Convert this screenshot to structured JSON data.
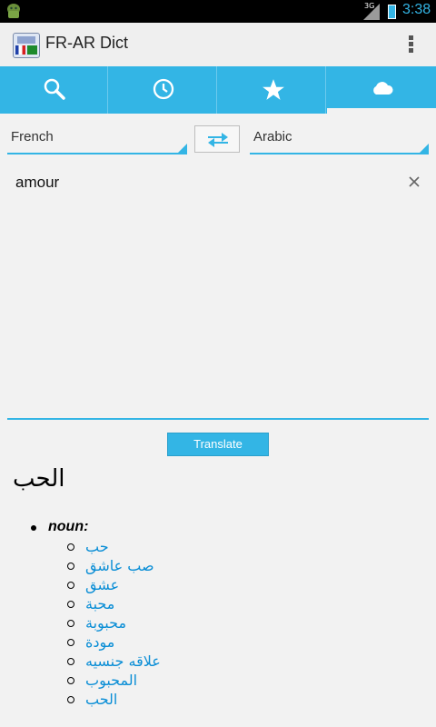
{
  "status_bar": {
    "network": "3G",
    "time": "3:38"
  },
  "action_bar": {
    "title": "FR-AR Dict",
    "icon": "app-dictionary-icon",
    "overflow_icon": "overflow-menu-icon"
  },
  "tabs": [
    {
      "icon": "search-icon",
      "active": false
    },
    {
      "icon": "history-clock-icon",
      "active": false
    },
    {
      "icon": "star-icon",
      "active": false
    },
    {
      "icon": "cloud-icon",
      "active": true
    }
  ],
  "languages": {
    "source": "French",
    "target": "Arabic",
    "swap_icon": "swap-arrows-icon"
  },
  "input": {
    "value": "amour",
    "clear_icon": "clear-icon"
  },
  "translate_button": "Translate",
  "result": {
    "headword": "الحب",
    "part_of_speech": "noun:",
    "senses": [
      "حب",
      "صب عاشق",
      "عشق",
      "محبة",
      "محبوبة",
      "مودة",
      "علاقه جنسيه",
      "المحبوب",
      "الحب"
    ]
  },
  "colors": {
    "accent": "#33b5e5",
    "link": "#0a8ed6"
  }
}
